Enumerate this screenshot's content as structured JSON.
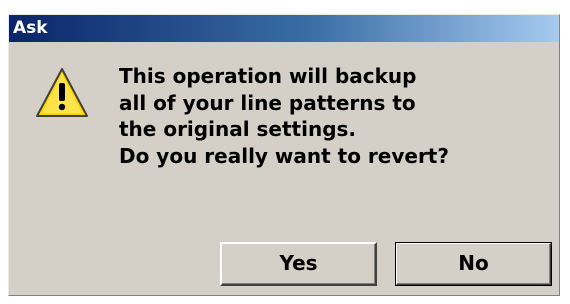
{
  "dialog": {
    "title": "Ask",
    "icon": "warning-icon",
    "message_lines": [
      "This operation will backup",
      "all of your line patterns to",
      "the original settings.",
      "Do you really want to revert?"
    ],
    "buttons": {
      "yes_label": "Yes",
      "no_label": "No"
    }
  },
  "colors": {
    "titlebar_start": "#0a246a",
    "titlebar_end": "#a6caf0",
    "face": "#d4d0c8",
    "warning_yellow": "#ffd700"
  }
}
